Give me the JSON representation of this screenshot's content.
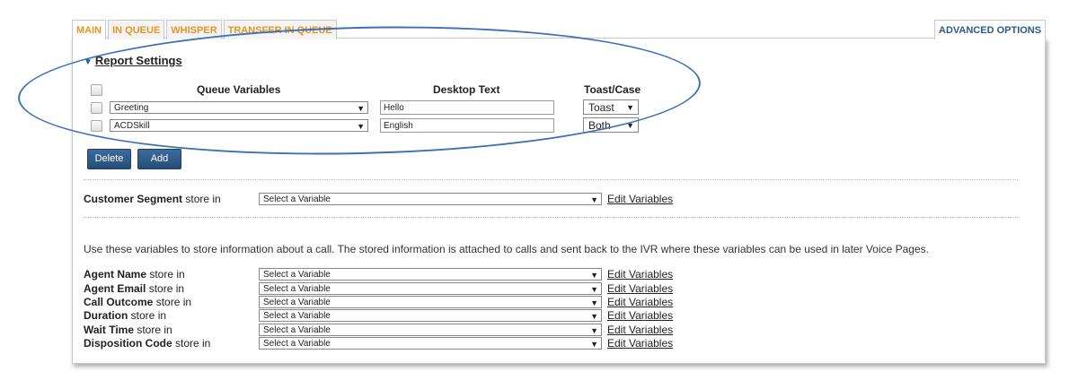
{
  "tabs": [
    "MAIN",
    "IN QUEUE",
    "WHISPER",
    "TRANSFER IN QUEUE"
  ],
  "advanced_tab": "ADVANCED OPTIONS",
  "report_settings": {
    "title": "Report Settings",
    "headers": {
      "queue_variables": "Queue Variables",
      "desktop_text": "Desktop Text",
      "toast_case": "Toast/Case"
    },
    "rows": [
      {
        "variable": "Greeting",
        "desktop_text": "Hello",
        "toast": "Toast"
      },
      {
        "variable": "ACDSkill",
        "desktop_text": "English",
        "toast": "Both"
      }
    ],
    "buttons": {
      "delete": "Delete",
      "add": "Add"
    }
  },
  "customer_segment": {
    "bold": "Customer Segment",
    "suffix": " store in",
    "value": "Select a Variable",
    "link": "Edit Variables"
  },
  "info_text": "Use these variables to store information about a call. The stored information is attached to calls and sent back to the IVR where these variables can be used in later Voice Pages.",
  "store_rows": [
    {
      "bold": "Agent Name",
      "suffix": " store in",
      "value": "Select a Variable",
      "link": "Edit Variables"
    },
    {
      "bold": "Agent Email",
      "suffix": " store in",
      "value": "Select a Variable",
      "link": "Edit Variables"
    },
    {
      "bold": "Call Outcome",
      "suffix": " store in",
      "value": "Select a Variable",
      "link": "Edit Variables"
    },
    {
      "bold": "Duration",
      "suffix": " store in",
      "value": "Select a Variable",
      "link": "Edit Variables"
    },
    {
      "bold": "Wait Time",
      "suffix": " store in",
      "value": "Select a Variable",
      "link": "Edit Variables"
    },
    {
      "bold": "Disposition Code",
      "suffix": " store in",
      "value": "Select a Variable",
      "link": "Edit Variables"
    }
  ],
  "colors": {
    "accent_tab": "#e8941f",
    "button": "#2c5a8a",
    "annotation": "#3f6fb6"
  },
  "icons": {
    "dropdown": "triangle-down-icon",
    "collapse": "triangle-down-icon"
  }
}
